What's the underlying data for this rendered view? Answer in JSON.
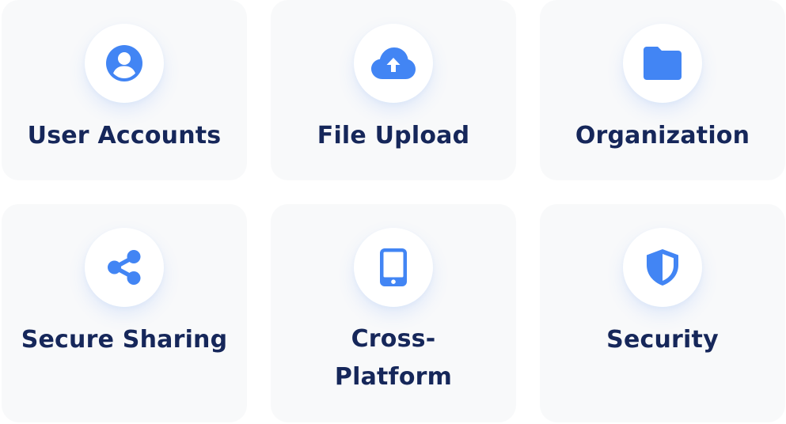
{
  "accent_color": "#4285f4",
  "text_color": "#16275a",
  "features": [
    {
      "label": "User Accounts",
      "icon": "user-circle-icon"
    },
    {
      "label": "File Upload",
      "icon": "cloud-upload-icon"
    },
    {
      "label": "Organization",
      "icon": "folder-icon"
    },
    {
      "label": "Secure Sharing",
      "icon": "share-icon"
    },
    {
      "label": "Cross-Platform",
      "icon": "smartphone-icon"
    },
    {
      "label": "Security",
      "icon": "shield-icon"
    }
  ]
}
